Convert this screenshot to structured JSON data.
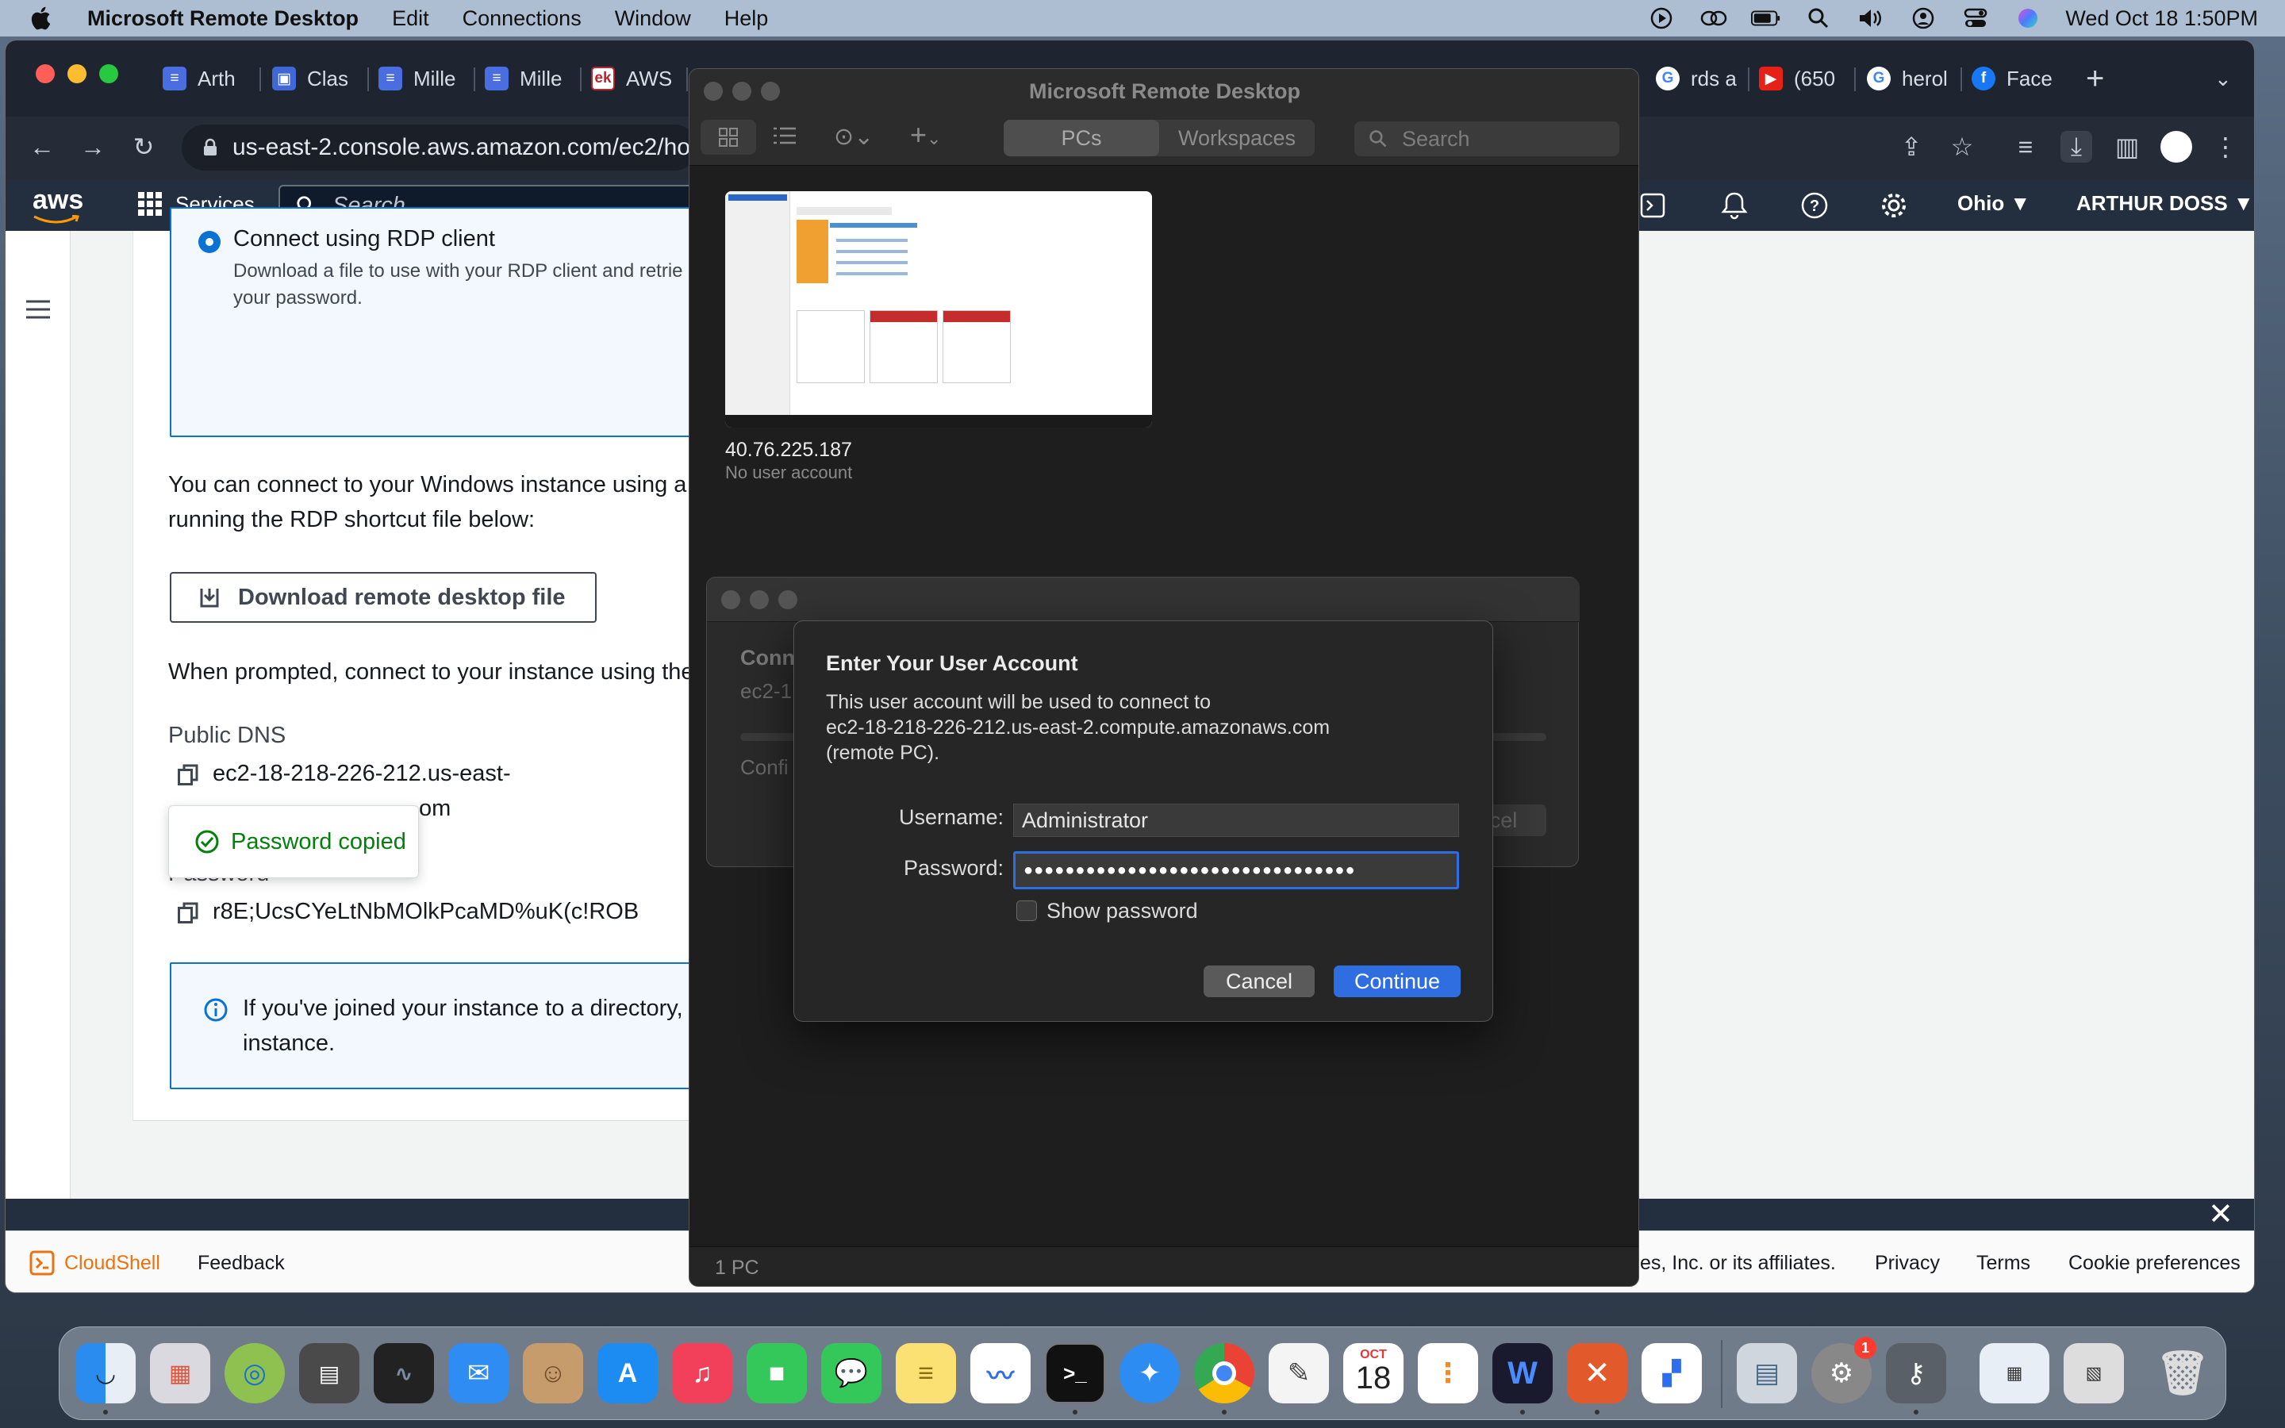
{
  "menubar": {
    "app_name": "Microsoft Remote Desktop",
    "items": [
      "Edit",
      "Connections",
      "Window",
      "Help"
    ],
    "clock": "Wed Oct 18  1:50PM"
  },
  "browser": {
    "tabs": [
      {
        "label": "Arth",
        "fav": "G",
        "color": "#4a6ee0"
      },
      {
        "label": "Clas",
        "fav": "C",
        "color": "#3f67d8"
      },
      {
        "label": "Mille",
        "fav": "G",
        "color": "#4a6ee0"
      },
      {
        "label": "Mille",
        "fav": "G",
        "color": "#4a6ee0"
      },
      {
        "label": "AWS",
        "fav": "ek",
        "color": "#b8262c"
      },
      {
        "label": "rds a",
        "fav": "G",
        "color": "#ffffff"
      },
      {
        "label": "(650",
        "fav": "▶",
        "color": "#e62117"
      },
      {
        "label": "herol",
        "fav": "G",
        "color": "#ffffff"
      },
      {
        "label": "Face",
        "fav": "f",
        "color": "#1877f2"
      }
    ],
    "url": "us-east-2.console.aws.amazon.com/ec2/ho"
  },
  "aws": {
    "logo": "aws",
    "services": "Services",
    "search_placeholder": "Search",
    "region": "Ohio ▼",
    "user": "ARTHUR DOSS ▼",
    "rdp_option_title": "Connect using RDP client",
    "rdp_option_desc_1": "Download a file to use with your RDP client and retrie",
    "rdp_option_desc_2": "your password.",
    "intro_1": "You can connect to your Windows instance using a re",
    "intro_2": "running the RDP shortcut file below:",
    "download_button": "Download remote desktop file",
    "prompt_text": "When prompted, connect to your instance using the",
    "public_dns_label": "Public DNS",
    "public_dns_1": "ec2-18-218-226-212.us-east-",
    "public_dns_2": "om",
    "password_label": "Password",
    "password_value": "r8E;UcsCYeLtNbMOlkPcaMD%uK(c!ROB",
    "toast": "Password copied",
    "info_1": "If you've joined your instance to a directory, y",
    "info_2": "instance.",
    "cloudshell": "CloudShell",
    "feedback": "Feedback",
    "copyright": "es, Inc. or its affiliates.",
    "footer_links": [
      "Privacy",
      "Terms",
      "Cookie preferences"
    ]
  },
  "mrd": {
    "title": "Microsoft Remote Desktop",
    "tabs": [
      "PCs",
      "Workspaces"
    ],
    "search_placeholder": "Search",
    "pc_name": "40.76.225.187",
    "pc_account": "No user account",
    "footer": "1 PC"
  },
  "connecting": {
    "title_partial": "Conn",
    "host_partial": "ec2-1",
    "status_partial": "Confi",
    "cancel_partial": "cel"
  },
  "dialog": {
    "title": "Enter Your User Account",
    "message_1": "This user account will be used to connect to",
    "message_2": "ec2-18-218-226-212.us-east-2.compute.amazonaws.com",
    "message_3": "(remote PC).",
    "username_label": "Username:",
    "username_value": "Administrator",
    "password_label": "Password:",
    "password_value": "●●●●●●●●●●●●●●●●●●●●●●●●●●●●●●●●",
    "show_password": "Show password",
    "cancel": "Cancel",
    "continue": "Continue"
  },
  "dock": {
    "calendar_month": "OCT",
    "calendar_day": "18",
    "settings_badge": "1"
  },
  "colors": {
    "aws_orange": "#ff9900",
    "aws_nav": "#232f3e",
    "primary_blue": "#0972d3",
    "mac_blue": "#2f6ee0",
    "success_green": "#037f0c"
  }
}
